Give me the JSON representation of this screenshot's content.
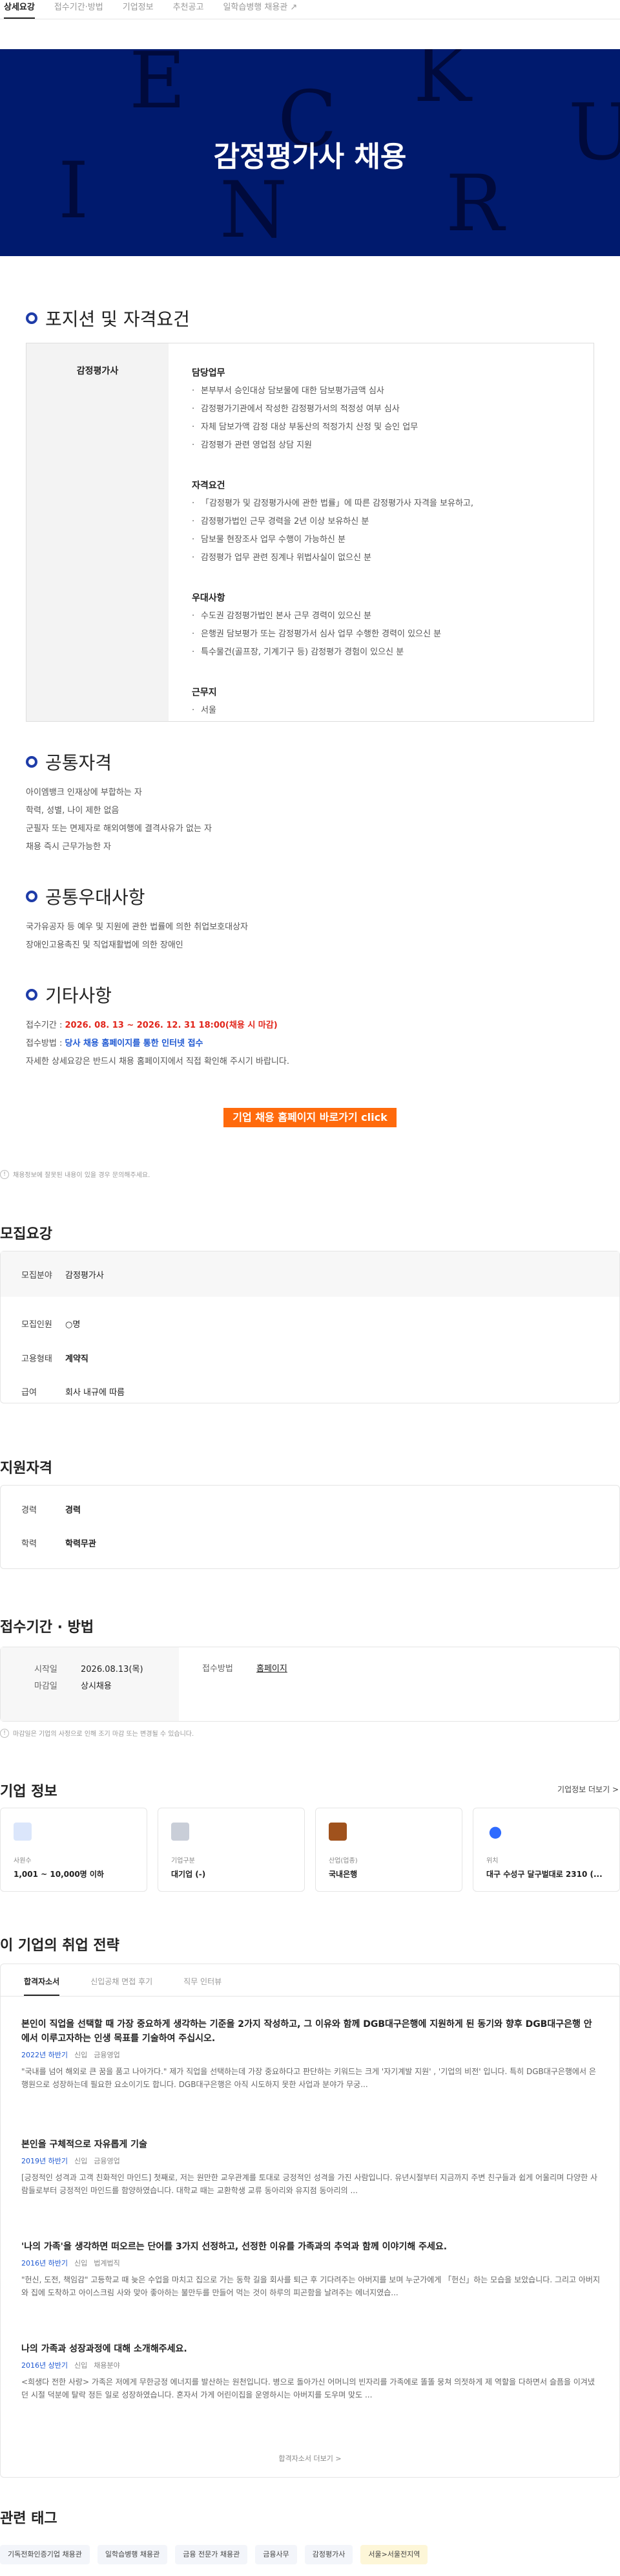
{
  "tabs": [
    "상세요강",
    "접수기간·방법",
    "기업정보",
    "추천공고",
    "일학습병행 채용관"
  ],
  "hero": {
    "title": "감정평가사 채용",
    "letters": [
      "E",
      "K",
      "C",
      "U",
      "I",
      "R",
      "N"
    ]
  },
  "sections": {
    "position": "포지션 및 자격요건",
    "common": "공통자격",
    "preference": "공통우대사항",
    "etc": "기타사항"
  },
  "position": {
    "name": "감정평가사",
    "duty_title": "담당업무",
    "duties": [
      "본부부서 승인대상 담보물에 대한 담보평가금액 심사",
      "감정평가기관에서 작성한 감정평가서의 적정성 여부 심사",
      "자체 담보가액 감정 대상 부동산의 적정가치 산정 및 승인 업무",
      "감정평가 관련 영업점 상담 지원"
    ],
    "req_title": "자격요건",
    "reqs": [
      "「감정평가 및 감정평가사에 관한 법률」에 따른 감정평가사 자격을 보유하고,",
      "감정평가법인 근무 경력을 2년 이상 보유하신 분",
      "담보물 현장조사 업무 수행이 가능하신 분",
      "감정평가 업무 관련 징계나 위법사실이 없으신 분"
    ],
    "pref_title": "우대사항",
    "prefs": [
      "수도권 감정평가법인 본사 근무 경력이 있으신 분",
      "은행권 담보평가 또는 감정평가서 심사 업무 수행한 경력이 있으신 분",
      "특수물건(골프장, 기계기구 등) 감정평가 경험이 있으신 분"
    ],
    "loc_title": "근무지",
    "locs": [
      "서울"
    ]
  },
  "common": [
    "아이엠뱅크 인재상에 부합하는 자",
    "학력, 성별, 나이 제한 없음",
    "군필자 또는 면제자로 해외여행에 결격사유가 없는 자",
    "채용 즉시 근무가능한 자"
  ],
  "preference": [
    "국가유공자 등 예우 및 지원에 관한 법률에 의한 취업보호대상자",
    "장애인고용촉진 및 직업재활법에 의한 장애인"
  ],
  "etc": {
    "period_label": "접수기간 : ",
    "period": "2026. 08. 13 ~ 2026. 12. 31 18:00(채용 시 마감)",
    "method_label": "접수방법 : ",
    "method": "당사 채용 홈페이지를 통한 인터넷 접수",
    "detail": "자세한 상세요강은 반드시 채용 홈페이지에서 직접 확인해 주시기 바랍니다."
  },
  "cta": "기업 채용 홈페이지 바로가기 click",
  "note1": "채용정보에 잘못된 내용이 있을 경우 문의해주세요.",
  "recruit": {
    "title": "모집요강",
    "field_k": "모집분야",
    "field_v": "감정평가사",
    "count_k": "모집인원",
    "count_v": "○명",
    "type_k": "고용형태",
    "type_v": "계약직",
    "pay_k": "급여",
    "pay_v": "회사 내규에 따름"
  },
  "qual": {
    "title": "지원자격",
    "exp_k": "경력",
    "exp_v": "경력",
    "edu_k": "학력",
    "edu_v": "학력무관"
  },
  "apply": {
    "title": "접수기간 · 방법",
    "start_k": "시작일",
    "start_v": "2026.08.13(목)",
    "end_k": "마감일",
    "end_v": "상시채용",
    "method_k": "접수방법",
    "method_v": "홈페이지"
  },
  "note2": "마감일은 기업의 사정으로 인해 조기 마감 또는 변경될 수 있습니다.",
  "company": {
    "title": "기업 정보",
    "more": "기업정보 더보기 >",
    "cards": [
      {
        "label": "사원수",
        "value": "1,001 ~ 10,000명 이하"
      },
      {
        "label": "기업구분",
        "value": "대기업 (-)"
      },
      {
        "label": "산업(업종)",
        "value": "국내은행"
      },
      {
        "label": "위치",
        "value": "대구 수성구 달구벌대로 2310 (..."
      }
    ]
  },
  "strategy": {
    "title": "이 기업의 취업 전략",
    "tabs": [
      "합격자소서",
      "신입공채 면접 후기",
      "직무 인터뷰"
    ],
    "items": [
      {
        "q": "본인이 직업을 선택할 때 가장 중요하게 생각하는 기준을 2가지 작성하고, 그 이유와 함께 DGB대구은행에 지원하게 된 동기와 향후 DGB대구은행 안에서 이루고자하는 인생 목표를 기술하여 주십시오.",
        "year": "2022년 하반기",
        "kind": "신입",
        "job": "금융영업",
        "a": "\"국내를 넘어 해외로 큰 꿈을 품고 나아가다.\" 제가 직업을 선택하는데 가장 중요하다고 판단하는 키워드는 크게 '자기계발 지원' , '기업의 비전' 입니다. 특히 DGB대구은행에서 은행원으로 성장하는데 필요한 요소이기도 합니다. DGB대구은행은 아직 시도하지 못한 사업과 분야가 무궁..."
      },
      {
        "q": "본인을 구체적으로 자유롭게 기술",
        "year": "2019년 하반기",
        "kind": "신입",
        "job": "금융영업",
        "a": "[긍정적인 성격과 고객 친화적인 마인드] 첫째로, 저는 원만한 교우관계를 토대로 긍정적인 성격을 가진 사람입니다. 유년시절부터 지금까지 주변 친구들과 쉽게 어울리며 다양한 사람들로부터 긍정적인 마인드를 함양하였습니다. 대학교 때는 교환학생 교류 동아리와 유지점 동아리의 ..."
      },
      {
        "q": "'나의 가족'을 생각하면 떠오르는 단어를 3가지 선정하고, 선정한 이유를 가족과의 추억과 함께 이야기해 주세요.",
        "year": "2016년 하반기",
        "kind": "신입",
        "job": "법계법직",
        "a": "\"헌신, 도전, 책임감\" 고등학교 때 늦은 수업을 마치고 집으로 가는 동학 길을 회사를 퇴근 후 기다려주는 아버지를 보며 누군가에게 「헌신」하는 모습을 보았습니다. 그리고 아버지와 집에 도착하고 아이스크림 사와 맞아 좋아하는 불만두를 만들어 먹는 것이 하루의 피곤함을 날려주는 에너지였습..."
      },
      {
        "q": "나의 가족과 성장과정에 대해 소개해주세요.",
        "year": "2016년 상반기",
        "kind": "신입",
        "job": "채용분야",
        "a": "<희생다 전한 사랑> 가족은 저에게 무한긍정 에너지를 발산하는 원천입니다. 병으로 돌아가신 어머니의 빈자리를 가족에로 똘똘 뭉쳐 의젓하게 제 역할을 다하면서 슬픔을 이겨냈던 시절 덕분에 탈락 정든 일로 성장하였습니다. 혼자서 가게 어린이집을 운영하시는 아버지를 도우며 맞도 ..."
      }
    ],
    "more": "합격자소서 더보기 >"
  },
  "tags": {
    "title": "관련 태그",
    "items": [
      "기독전화인증기업 채용관",
      "일학습병행 채용관",
      "금융 전문가 채용관",
      "금융사무",
      "감정평가사",
      "서울>서울전지역"
    ]
  },
  "colors": {
    "hero": "#001a6e",
    "accent": "#1e3ca8",
    "cta": "#ff6a0c",
    "red": "#e1251b",
    "link": "#1e58d2"
  }
}
